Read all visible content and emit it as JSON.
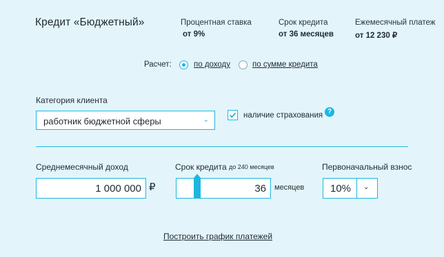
{
  "header": {
    "title": "Кредит «Бюджетный»",
    "rate": {
      "label": "Процентная ставка",
      "value": "от 9%"
    },
    "term": {
      "label": "Срок кредита",
      "value": "от 36 месяцев"
    },
    "payment": {
      "label": "Ежемесячный платеж",
      "value": "от 12 230 ₽"
    }
  },
  "calc": {
    "label": "Расчет:",
    "options": [
      {
        "label": "по доходу",
        "checked": true
      },
      {
        "label": "по сумме кредита",
        "checked": false
      }
    ]
  },
  "client": {
    "label": "Категория клиента",
    "selected": "работник бюджетной сферы"
  },
  "insurance": {
    "label": "наличие страхования",
    "checked": true,
    "help": "?"
  },
  "income": {
    "label": "Среднемесячный доход",
    "value": "1 000 000",
    "currency": "₽"
  },
  "loan_term": {
    "label": "Срок кредита",
    "hint": "до 240 месяцев",
    "value": "36",
    "units": "месяцев",
    "slider_fraction": 0.15
  },
  "down_payment": {
    "label": "Первоначальный взнос",
    "value": "10%"
  },
  "schedule_link": "Построить график платежей",
  "colors": {
    "accent": "#1cb7e0",
    "background": "#e3f5fb"
  }
}
